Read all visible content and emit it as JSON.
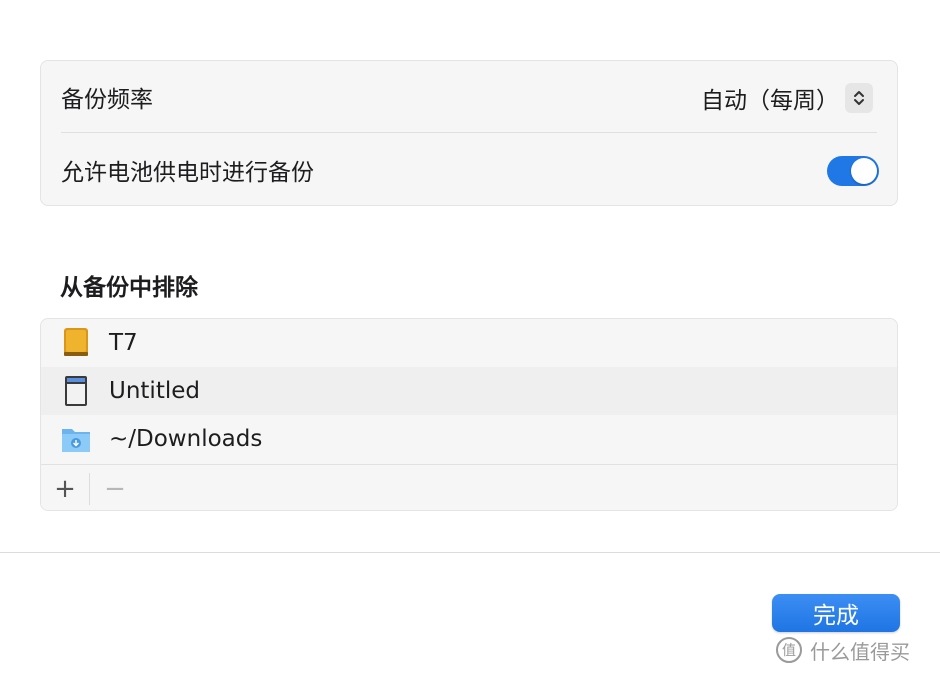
{
  "settings": {
    "backup_frequency_label": "备份频率",
    "backup_frequency_value": "自动（每周）",
    "battery_label": "允许电池供电时进行备份",
    "battery_toggle_on": true
  },
  "exclude": {
    "title": "从备份中排除",
    "items": [
      {
        "label": "T7",
        "icon": "external-drive-icon"
      },
      {
        "label": "Untitled",
        "icon": "sd-card-icon"
      },
      {
        "label": "~/Downloads",
        "icon": "downloads-folder-icon"
      }
    ],
    "add_symbol": "+",
    "remove_symbol": "−"
  },
  "footer": {
    "done_label": "完成"
  },
  "watermark": {
    "text": "什么值得买",
    "icon_text": "值"
  },
  "colors": {
    "accent": "#1f78e6",
    "panel_bg": "#f6f6f6"
  }
}
